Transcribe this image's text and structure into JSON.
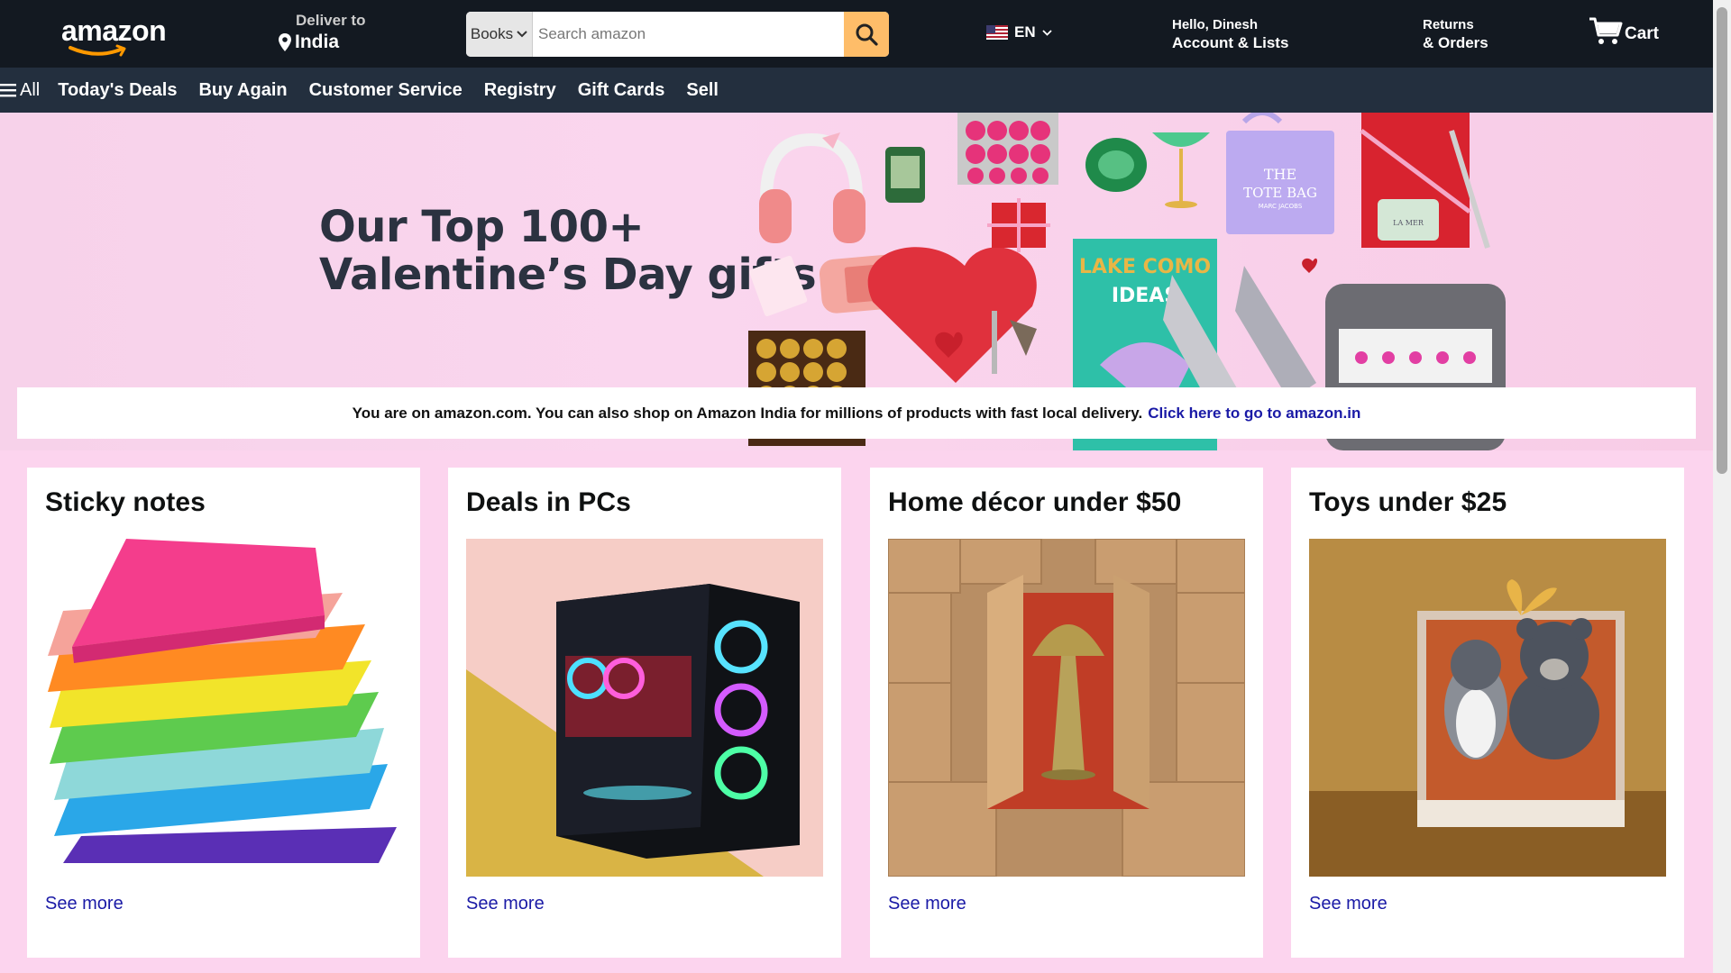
{
  "header": {
    "logo_text": "amazon",
    "deliver_label": "Deliver to",
    "deliver_location": "India",
    "search": {
      "category": "Books",
      "placeholder": "Search amazon"
    },
    "language": "EN",
    "account": {
      "greeting": "Hello, Dinesh",
      "label": "Account & Lists"
    },
    "returns": {
      "line1": "Returns",
      "line2": "& Orders"
    },
    "cart_label": "Cart"
  },
  "subnav": {
    "all_label": "All",
    "items": [
      "Today's Deals",
      "Buy Again",
      "Customer Service",
      "Registry",
      "Gift Cards",
      "Sell"
    ]
  },
  "hero": {
    "title_line1": "Our Top 100+",
    "title_line2": "Valentine’s Day gifts",
    "art_text": [
      "THE",
      "TOTE BAG",
      "MARC JACOBS",
      "LAKE COMO",
      "IDEAS",
      "LA MER"
    ]
  },
  "notice": {
    "text": "You are on amazon.com. You can also shop on Amazon India for millions of products with fast local delivery.",
    "link": "Click here to go to amazon.in"
  },
  "cards": [
    {
      "title": "Sticky notes",
      "link": "See more"
    },
    {
      "title": "Deals in PCs",
      "link": "See more"
    },
    {
      "title": "Home décor under $50",
      "link": "See more"
    },
    {
      "title": "Toys under $25",
      "link": "See more"
    }
  ],
  "colors": {
    "nav_bg": "#131921",
    "subnav_bg": "#232f3e",
    "search_button": "#febd69",
    "page_bg": "#fcd4ee",
    "link": "#1a1aa6"
  }
}
